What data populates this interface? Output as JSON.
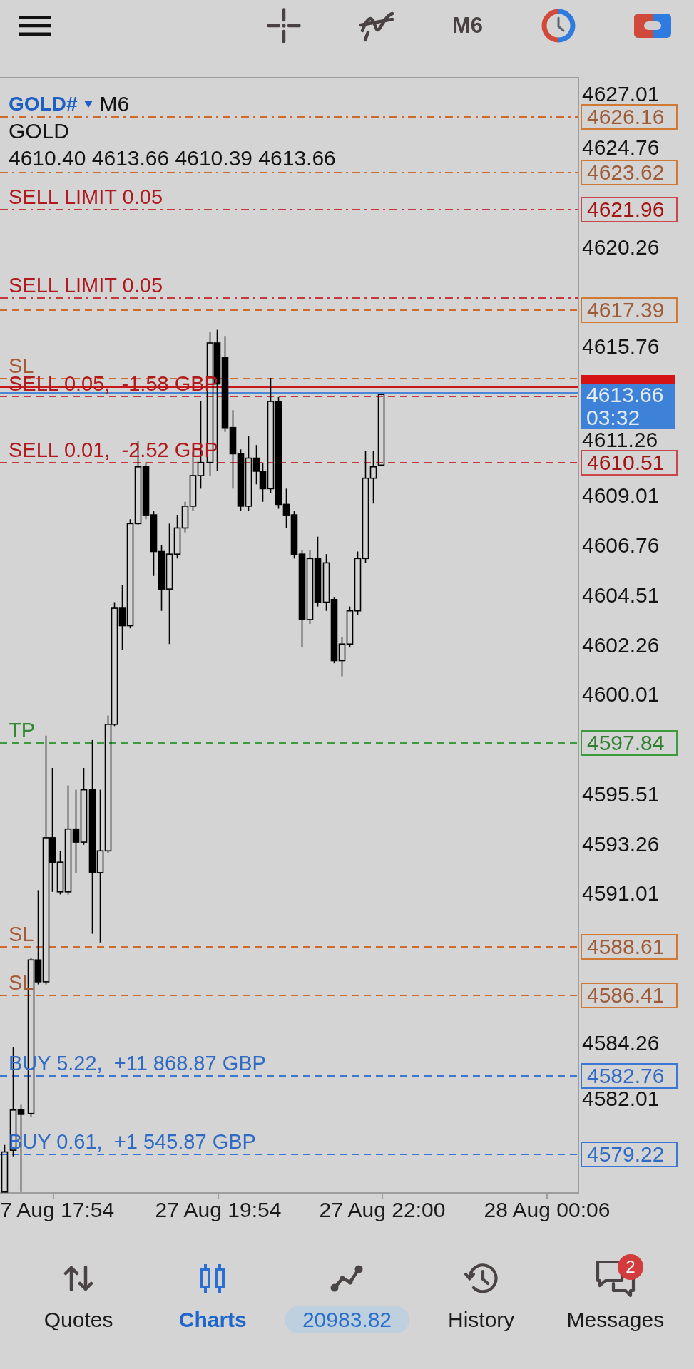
{
  "toolbar": {
    "timeframe": "M6"
  },
  "chart": {
    "symbol": "GOLD#",
    "timeframe": "M6",
    "description": "GOLD",
    "ohlc": "4610.40 4613.66 4610.39 4613.66",
    "levels": [
      {
        "kind": "stop_loss",
        "pending": true,
        "tag": "4626.16"
      },
      {
        "kind": "stop_loss",
        "pending": true,
        "tag": "4623.62"
      },
      {
        "kind": "sell_limit",
        "pending": true,
        "label": "SELL LIMIT 0.05",
        "tag": "4621.96"
      },
      {
        "kind": "sell_limit",
        "pending": true,
        "label": "SELL LIMIT 0.05"
      },
      {
        "kind": "stop_loss",
        "pending": false,
        "tag": "4617.39"
      },
      {
        "kind": "stop_loss",
        "pending": false,
        "label": "SL"
      },
      {
        "kind": "sell",
        "pending": false,
        "label": "SELL 0.05,  -1.58 GBP"
      },
      {
        "kind": "ask"
      },
      {
        "kind": "bid",
        "tag": "4613.66",
        "timer": "03:32"
      },
      {
        "kind": "sell",
        "pending": false,
        "label": "SELL 0.01,  -2.52 GBP",
        "tag": "4610.51"
      },
      {
        "kind": "take_profit",
        "pending": false,
        "label": "TP",
        "tag": "4597.84"
      },
      {
        "kind": "stop_loss",
        "pending": false,
        "label": "SL",
        "tag": "4588.61"
      },
      {
        "kind": "stop_loss",
        "pending": false,
        "label": "SL",
        "tag": "4586.41"
      },
      {
        "kind": "buy",
        "pending": false,
        "label": "BUY 5.22,  +11 868.87 GBP",
        "tag": "4582.76"
      },
      {
        "kind": "buy",
        "pending": false,
        "label": "BUY 0.61,  +1 545.87 GBP",
        "tag": "4579.22"
      }
    ],
    "price_axis": [
      "4627.01",
      "4624.76",
      "4620.26",
      "4615.76",
      "4611.26",
      "4609.01",
      "4606.76",
      "4604.51",
      "4602.26",
      "4600.01",
      "4595.51",
      "4593.26",
      "4591.01",
      "4584.26",
      "4582.01"
    ],
    "time_axis": [
      "7 Aug 17:54",
      "27 Aug 19:54",
      "27 Aug 22:00",
      "28 Aug 00:06"
    ]
  },
  "bottom_nav": [
    {
      "kind": "tab",
      "label": "Quotes",
      "selected": false
    },
    {
      "kind": "tab",
      "label": "Charts",
      "selected": true
    },
    {
      "kind": "balance",
      "label": "20983.82",
      "selected": false
    },
    {
      "kind": "tab",
      "label": "History",
      "selected": false
    },
    {
      "kind": "tab",
      "label": "Messages",
      "selected": false,
      "badge": "2"
    }
  ]
}
